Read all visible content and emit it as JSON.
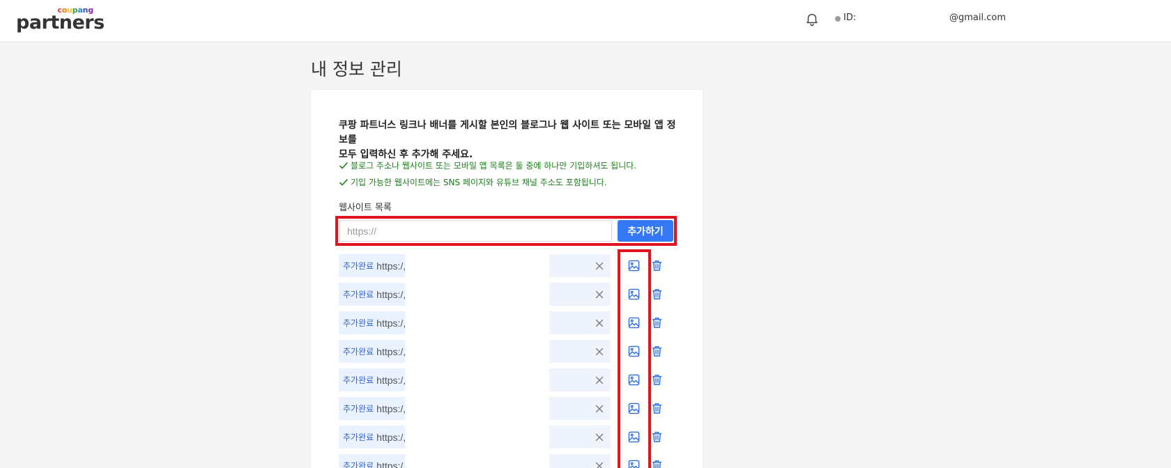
{
  "header": {
    "logo_sub": "coupang",
    "logo_main": "partners",
    "id_label": "ID:",
    "email": "@gmail.com"
  },
  "colors": {
    "accent": "#3478f6",
    "highlight_red": "#e0141e",
    "note_green": "#1a7f1a",
    "pill_bg": "#eaf1ff",
    "logo_letters": [
      "#e53935",
      "#f57c00",
      "#fbc02d",
      "#43a047",
      "#1e88e5",
      "#3949ab",
      "#8e24aa"
    ]
  },
  "page": {
    "title": "내 정보 관리"
  },
  "form": {
    "intro_line1": "쿠팡 파트너스 링크나 배너를 게시할 본인의 블로그나 웹 사이트 또는 모바일 앱 정보를",
    "intro_line2": "모두 입력하신 후 추가해 주세요.",
    "note1": "블로그 주소나 웹사이트 또는 모바일 앱 목록은 둘 중에 하나만 기입하셔도 됩니다.",
    "note2": "기입 가능한 웹사이트에는 SNS 페이지와 유튜브 채널 주소도 포함됩니다.",
    "section_label": "웹사이트 목록",
    "url_placeholder": "https://",
    "add_button": "추가하기"
  },
  "sites": [
    {
      "status": "추가완료",
      "url": "https:/,"
    },
    {
      "status": "추가완료",
      "url": "https:/,"
    },
    {
      "status": "추가완료",
      "url": "https:/,"
    },
    {
      "status": "추가완료",
      "url": "https:/,"
    },
    {
      "status": "추가완료",
      "url": "https:/,"
    },
    {
      "status": "추가완료",
      "url": "https:/,"
    },
    {
      "status": "추가완료",
      "url": "https:/,"
    },
    {
      "status": "추가완료",
      "url": "https:/,"
    }
  ],
  "icons": {
    "bell": "bell-icon",
    "check": "check-icon",
    "clear": "close-icon",
    "image": "image-icon",
    "delete": "trash-icon"
  }
}
